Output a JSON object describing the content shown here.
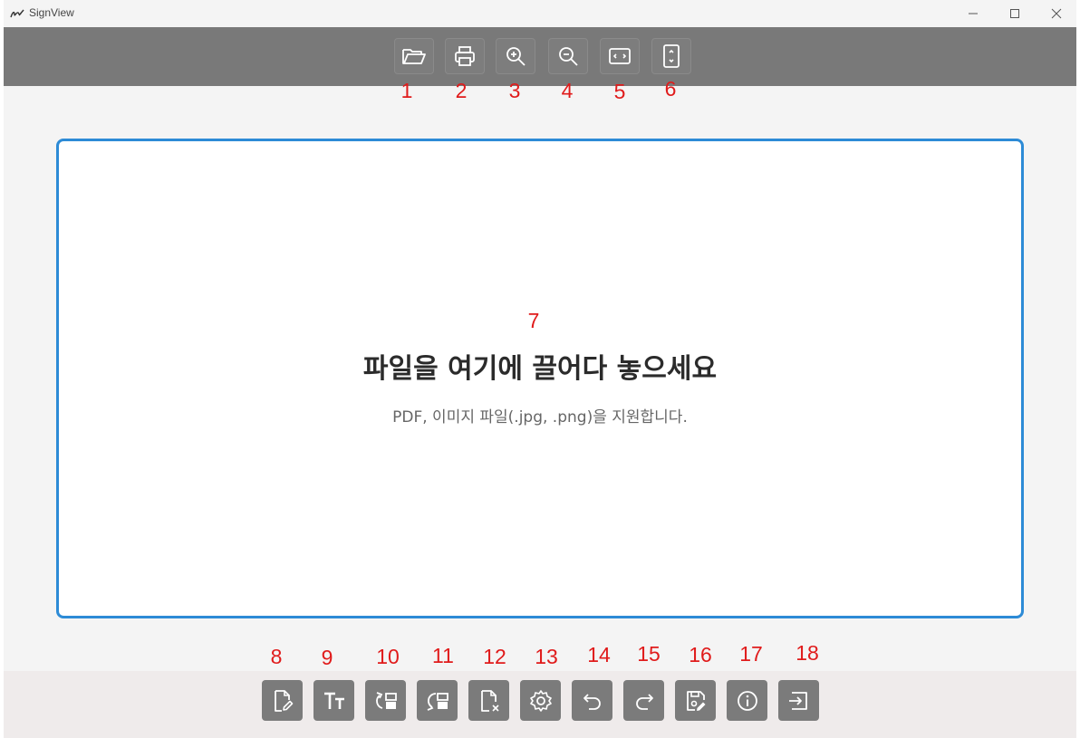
{
  "window": {
    "title": "SignView"
  },
  "drop_zone": {
    "title": "파일을 여기에 끌어다 놓으세요",
    "subtitle": "PDF, 이미지 파일(.jpg, .png)을 지원합니다."
  },
  "markers": [
    "1",
    "2",
    "3",
    "4",
    "5",
    "6",
    "7",
    "8",
    "9",
    "10",
    "11",
    "12",
    "13",
    "14",
    "15",
    "16",
    "17",
    "18"
  ],
  "colors": {
    "toolbar": "#797979",
    "accent": "#2d8bd6",
    "marker": "#e01b1b"
  },
  "top_toolbar": [
    "open-file-icon",
    "print-icon",
    "zoom-in-icon",
    "zoom-out-icon",
    "fit-width-icon",
    "fit-height-icon"
  ],
  "bottom_toolbar": [
    "sign-document-icon",
    "text-icon",
    "rotate-right-icon",
    "rotate-left-icon",
    "delete-page-icon",
    "settings-icon",
    "undo-icon",
    "redo-icon",
    "save-icon",
    "info-icon",
    "exit-icon"
  ]
}
